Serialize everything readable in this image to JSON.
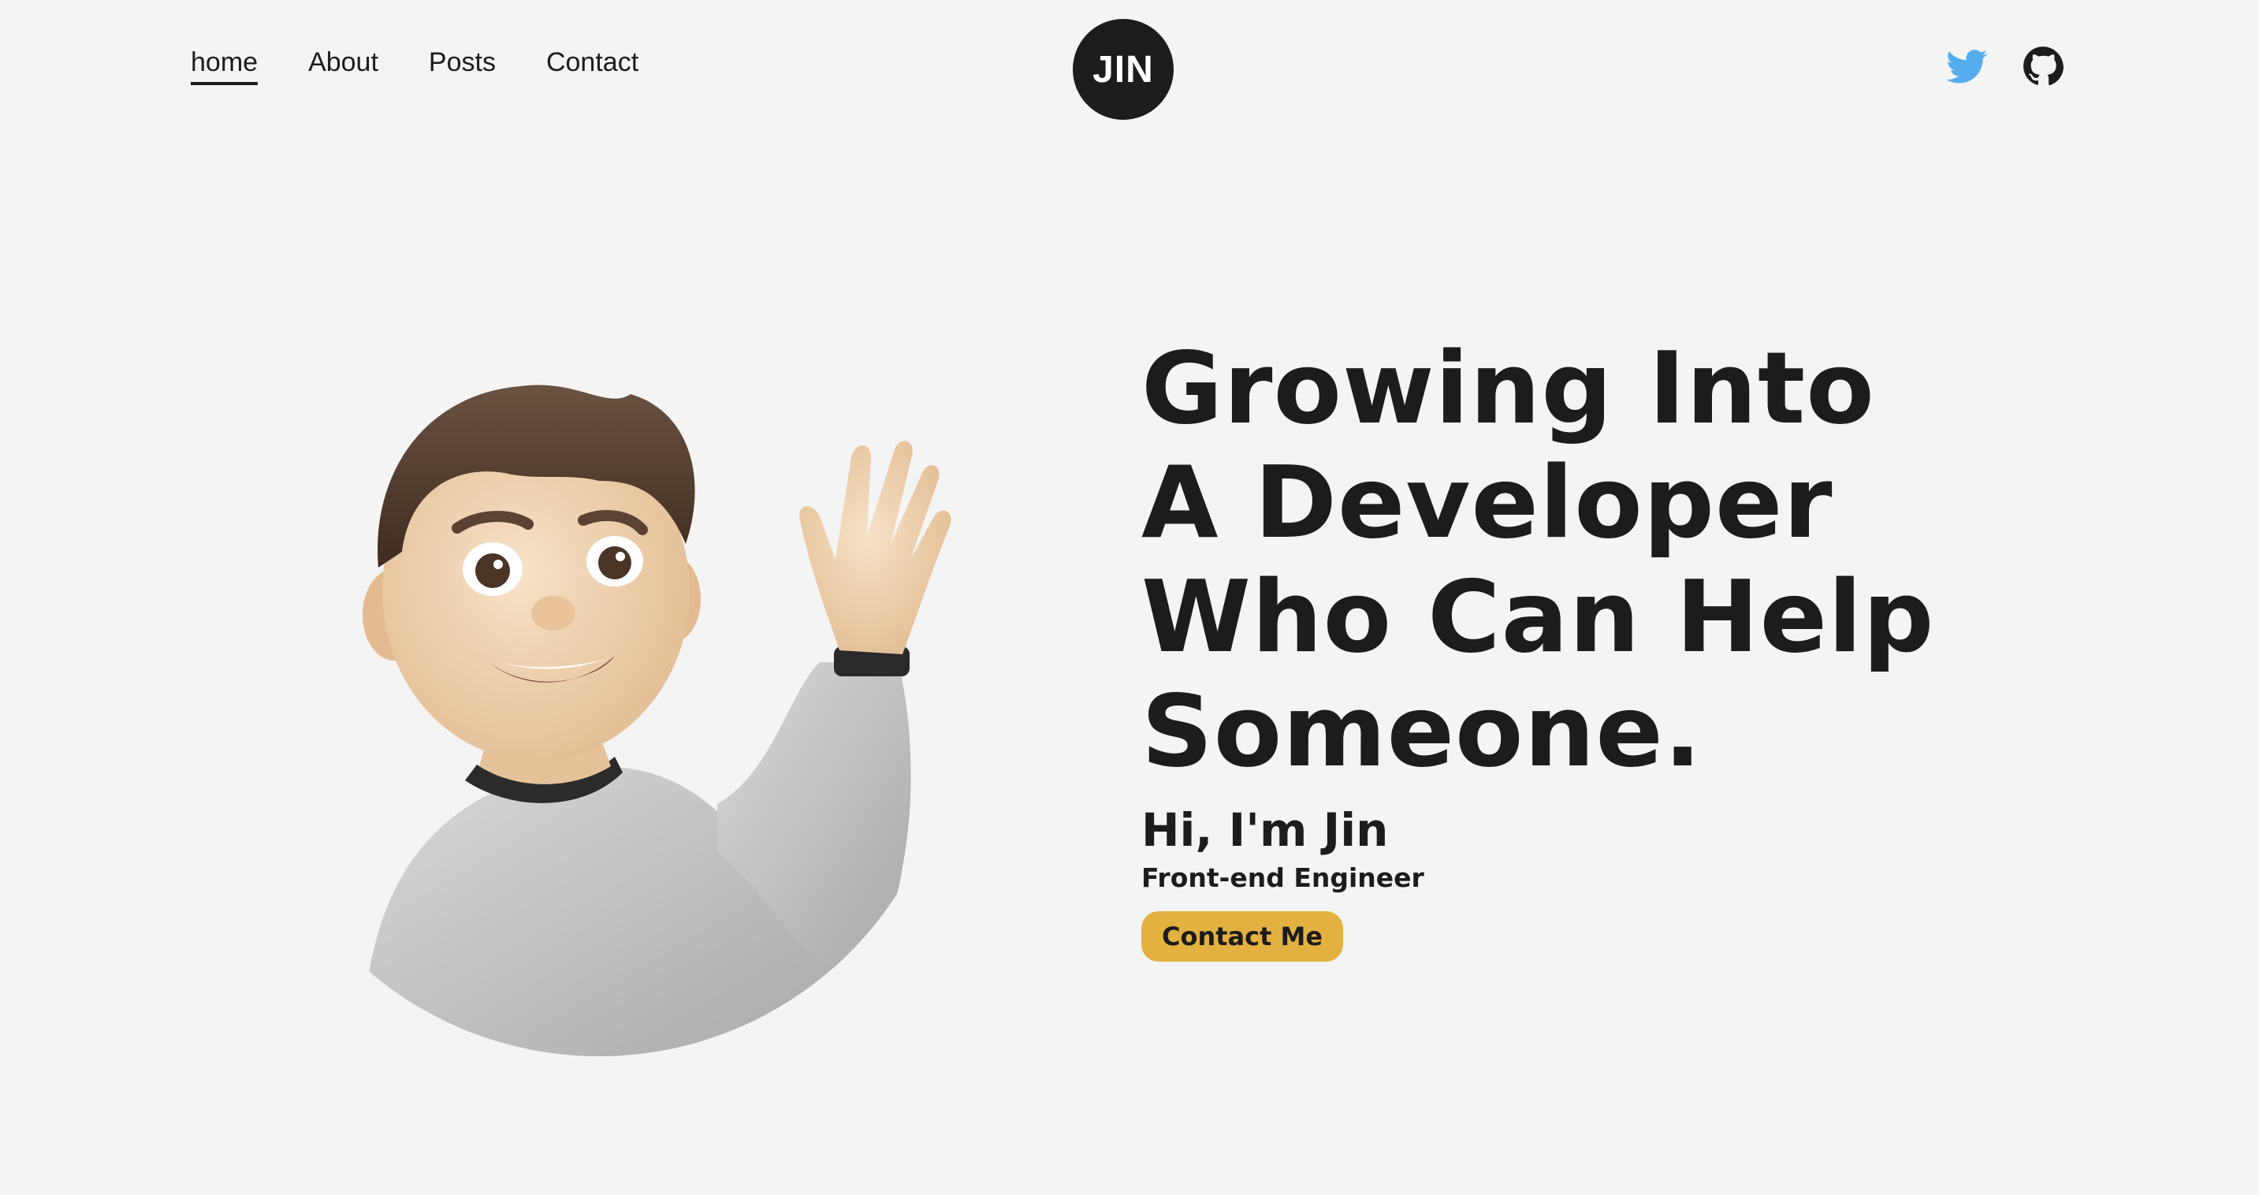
{
  "header": {
    "nav": [
      {
        "label": "home",
        "active": true
      },
      {
        "label": "About",
        "active": false
      },
      {
        "label": "Posts",
        "active": false
      },
      {
        "label": "Contact",
        "active": false
      }
    ],
    "logo_text": "JIN",
    "social": [
      {
        "icon": "twitter-icon",
        "color": "#55acee"
      },
      {
        "icon": "github-icon",
        "color": "#1c1c1c"
      }
    ]
  },
  "hero": {
    "headline_lines": [
      "Growing Into",
      "A Developer",
      "Who Can Help",
      "Someone."
    ],
    "greeting": "Hi, I'm Jin",
    "role": "Front-end Engineer",
    "cta_label": "Contact Me",
    "avatar_icon": "waving-memoji-avatar"
  },
  "colors": {
    "background": "#f4f4f4",
    "text": "#1c1c1c",
    "accent": "#e3b13f",
    "twitter": "#55acee"
  }
}
